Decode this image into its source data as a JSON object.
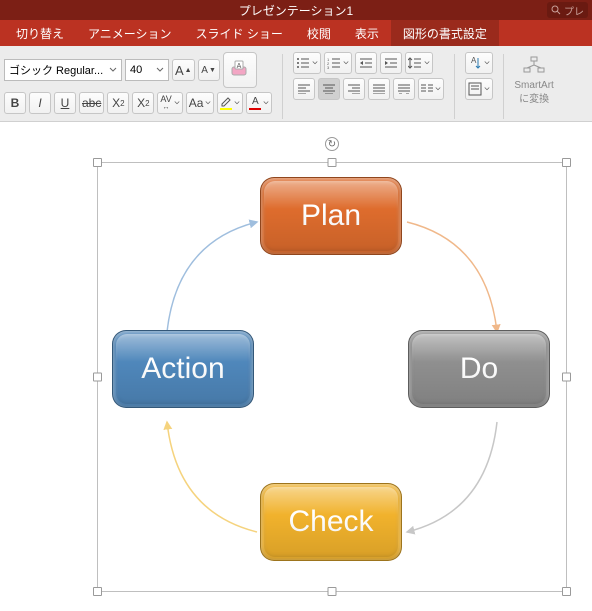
{
  "titlebar": {
    "title": "プレゼンテーション1",
    "search_placeholder": "プレ"
  },
  "tabs": {
    "items": [
      {
        "label": "切り替え"
      },
      {
        "label": "アニメーション"
      },
      {
        "label": "スライド ショー"
      },
      {
        "label": "校閲"
      },
      {
        "label": "表示"
      },
      {
        "label": "図形の書式設定"
      }
    ],
    "active_index": 5
  },
  "ribbon": {
    "font_name": "ゴシック Regular...",
    "font_size": "40",
    "increase_font": "A",
    "decrease_font": "A",
    "bold": "B",
    "italic": "I",
    "underline": "U",
    "strike": "abc",
    "super": "X",
    "sub": "X",
    "char_spacing": "AV",
    "change_case": "Aa",
    "font_color_letter": "A",
    "smartart_line1": "SmartArt",
    "smartart_line2": "に変換"
  },
  "diagram": {
    "plan": "Plan",
    "do": "Do",
    "check": "Check",
    "action": "Action",
    "rotate_glyph": "↻"
  },
  "colors": {
    "plan": "#de6c2d",
    "do": "#8f8f8f",
    "check": "#f1b22c",
    "action": "#4f87bb"
  }
}
